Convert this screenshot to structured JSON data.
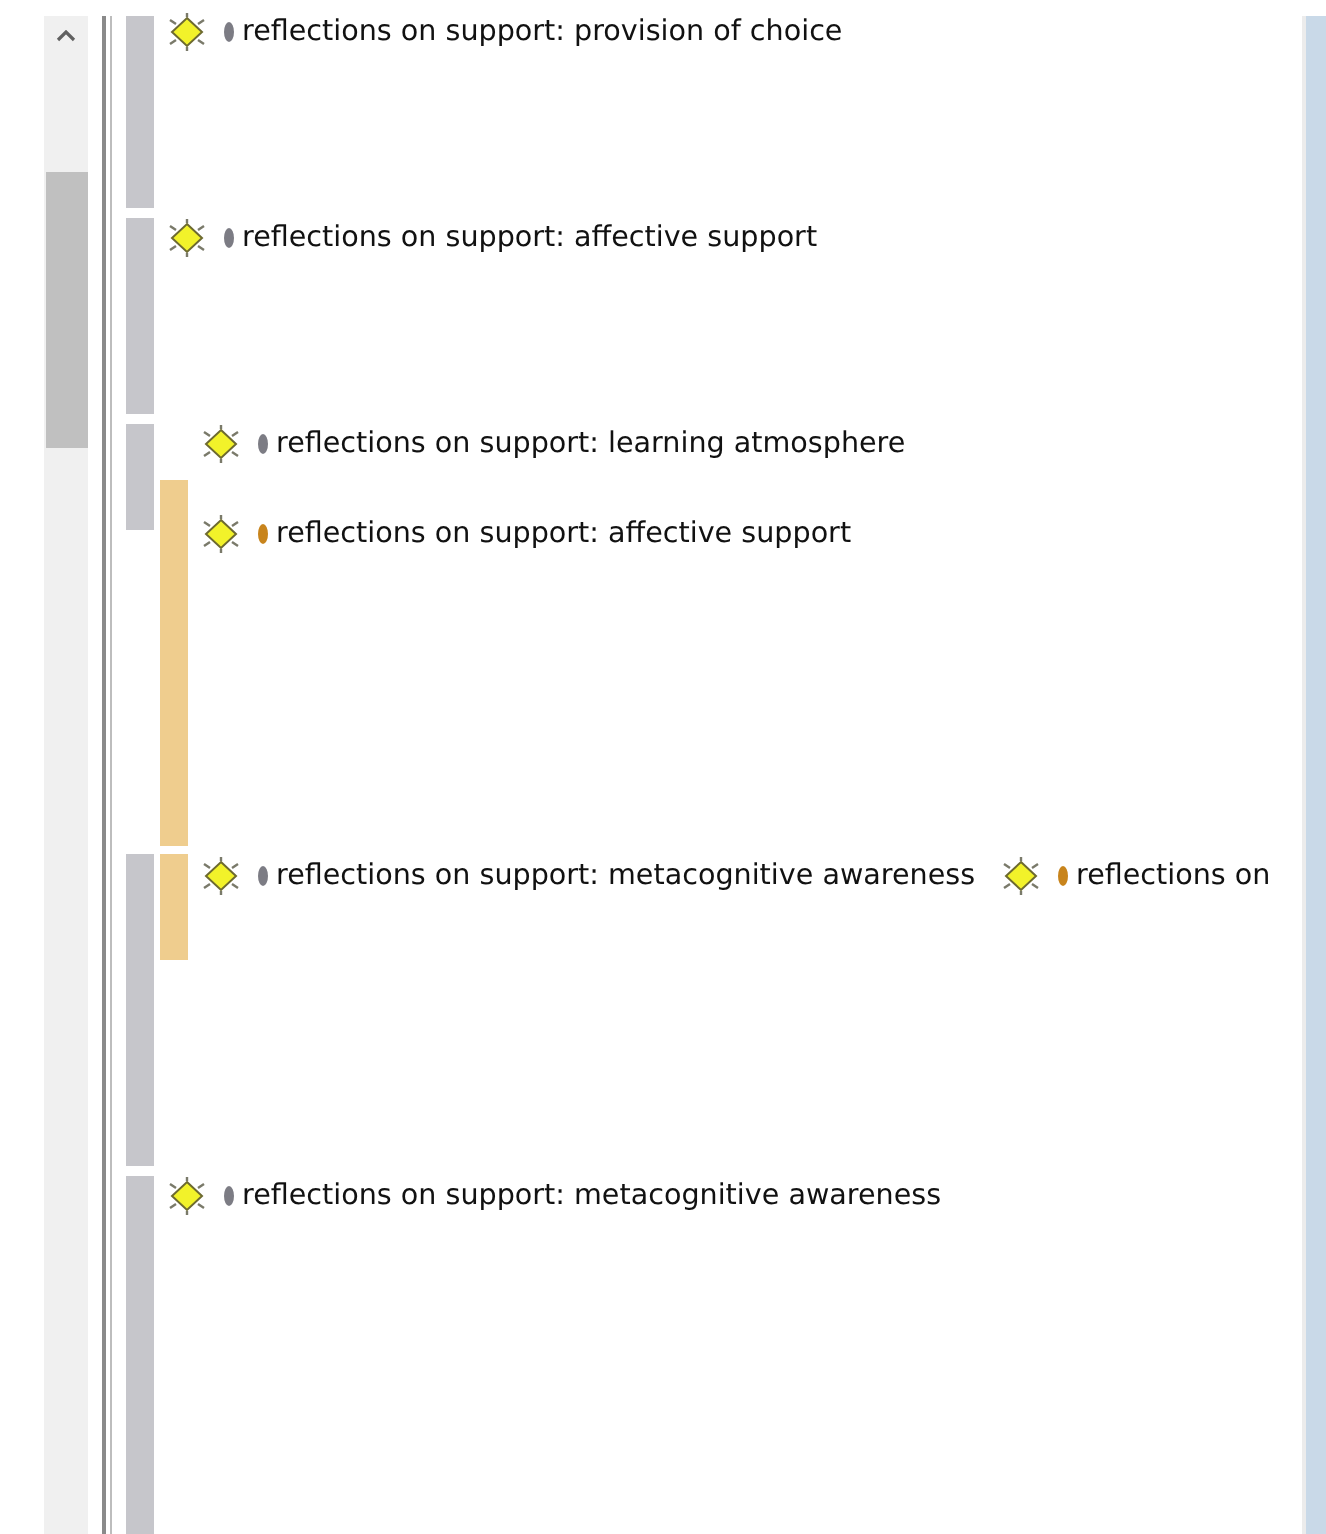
{
  "stripes": [
    {
      "color": "#c6c6cb",
      "kind": "outer"
    },
    {
      "color": "#c6c6cb",
      "kind": "outer"
    },
    {
      "color": "#c6c6cb",
      "kind": "outer"
    },
    {
      "color": "#efcd8e",
      "kind": "inner"
    },
    {
      "color": "#c6c6cb",
      "kind": "outer"
    },
    {
      "color": "#efcd8e",
      "kind": "inner"
    },
    {
      "color": "#c6c6cb",
      "kind": "outer"
    }
  ],
  "codes": [
    {
      "label": "reflections on support: provision of choice",
      "color": "#7c7c84"
    },
    {
      "label": "reflections on support: affective support",
      "color": "#7c7c84"
    },
    {
      "label": "reflections on support: learning atmosphere",
      "color": "#7c7c84"
    },
    {
      "label": "reflections on support: affective support",
      "color": "#c8841c"
    },
    {
      "label": "reflections on support: metacognitive awareness",
      "color": "#7c7c84"
    },
    {
      "label": "reflections on",
      "color": "#c8841c"
    },
    {
      "label": "reflections on support: metacognitive awareness",
      "color": "#7c7c84"
    }
  ]
}
